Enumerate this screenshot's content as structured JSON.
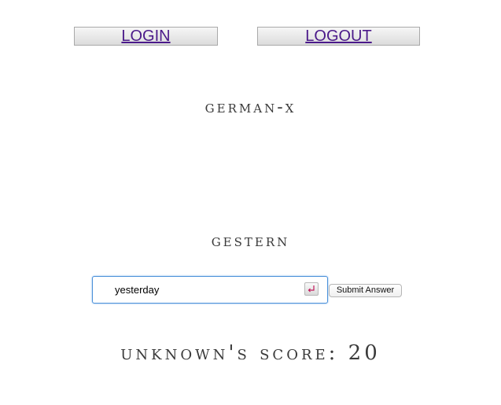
{
  "nav": {
    "login_label": "LOGIN",
    "logout_label": "LOGOUT"
  },
  "app": {
    "title": "German-X"
  },
  "quiz": {
    "word": "Gestern",
    "answer_value": "yesterday",
    "submit_label": "Submit Answer"
  },
  "score": {
    "text": "Unknown's score: 20"
  },
  "colors": {
    "link": "#4b1a8a",
    "focus_border": "#4a90d9",
    "heading_text": "#3a3a3a"
  },
  "icons": {
    "input_accessory": "enter-key-icon"
  }
}
